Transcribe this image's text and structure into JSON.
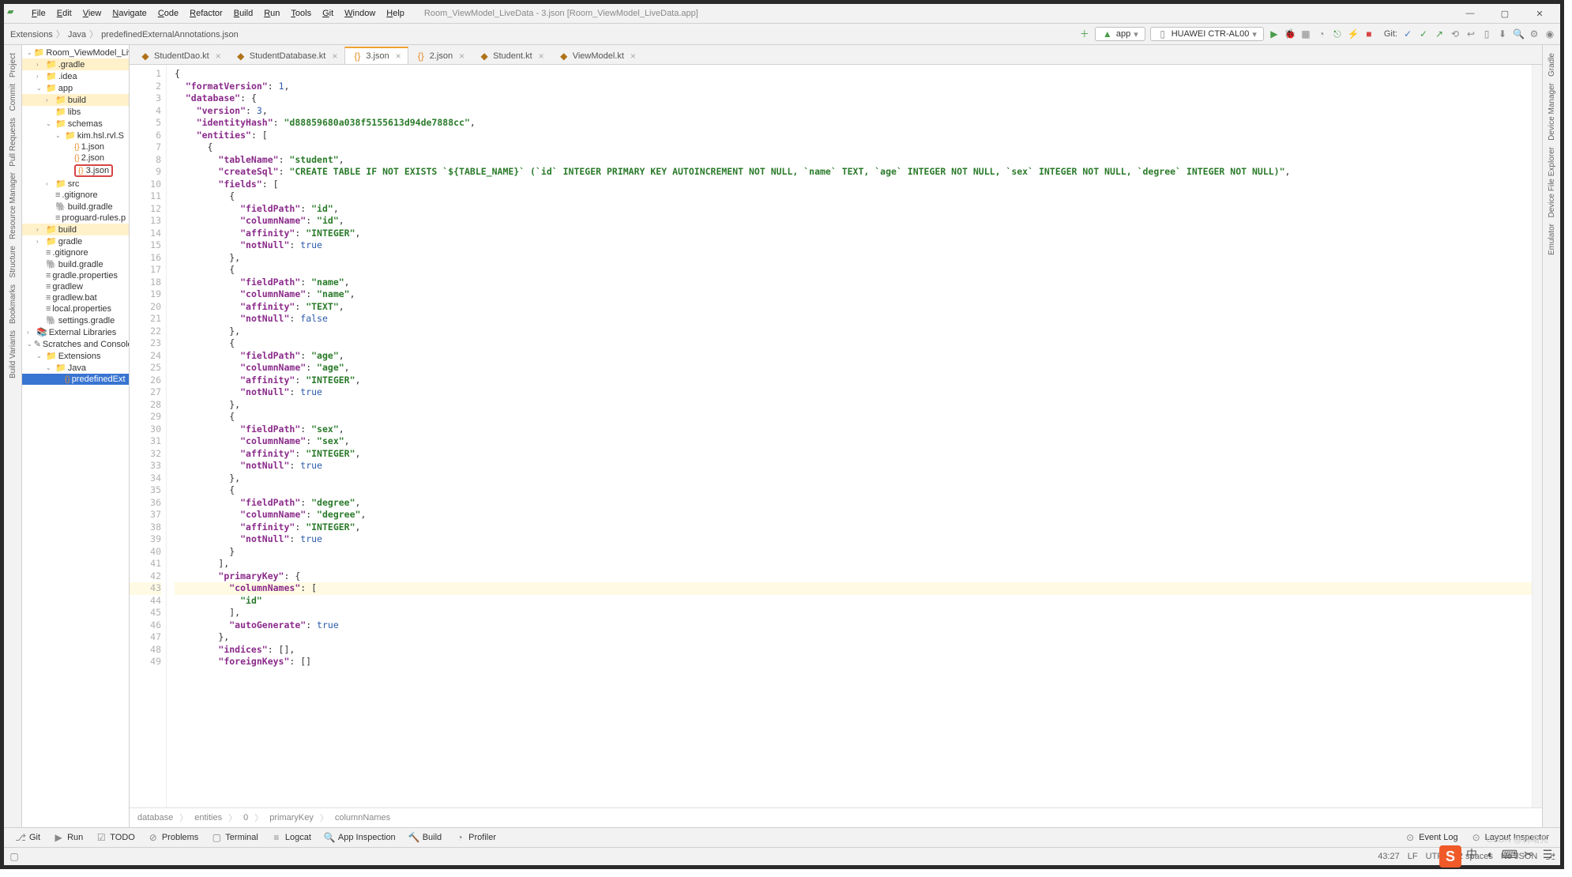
{
  "window_title": "Room_ViewModel_LiveData - 3.json [Room_ViewModel_LiveData.app]",
  "menu": [
    "File",
    "Edit",
    "View",
    "Navigate",
    "Code",
    "Refactor",
    "Build",
    "Run",
    "Tools",
    "Git",
    "Window",
    "Help"
  ],
  "breadcrumbs": [
    "Extensions",
    "Java",
    "predefinedExternalAnnotations.json"
  ],
  "run_config": "app",
  "device": "HUAWEI CTR-AL00",
  "git_label": "Git:",
  "editor_tabs": [
    {
      "label": "StudentDao.kt",
      "icon": "kotlin",
      "active": false
    },
    {
      "label": "StudentDatabase.kt",
      "icon": "kotlin",
      "active": false
    },
    {
      "label": "3.json",
      "icon": "json",
      "active": true
    },
    {
      "label": "2.json",
      "icon": "json",
      "active": false
    },
    {
      "label": "Student.kt",
      "icon": "kotlin",
      "active": false
    },
    {
      "label": "ViewModel.kt",
      "icon": "kotlin",
      "active": false
    }
  ],
  "left_tabs": [
    "Project",
    "Commit",
    "Pull Requests",
    "Resource Manager",
    "Structure",
    "Bookmarks",
    "Build Variants"
  ],
  "right_tabs": [
    "Gradle",
    "Device Manager",
    "Device File Explorer",
    "Emulator"
  ],
  "tree": [
    {
      "d": 0,
      "a": "v",
      "i": "proj",
      "t": "Room_ViewModel_LiveDa"
    },
    {
      "d": 1,
      "a": ">",
      "i": "fold-hi",
      "t": ".gradle",
      "hi": true
    },
    {
      "d": 1,
      "a": ">",
      "i": "fold",
      "t": ".idea"
    },
    {
      "d": 1,
      "a": "v",
      "i": "mod",
      "t": "app"
    },
    {
      "d": 2,
      "a": ">",
      "i": "fold-hi",
      "t": "build",
      "hi": true
    },
    {
      "d": 2,
      "a": "",
      "i": "fold",
      "t": "libs"
    },
    {
      "d": 2,
      "a": "v",
      "i": "fold",
      "t": "schemas"
    },
    {
      "d": 3,
      "a": "v",
      "i": "fold",
      "t": "kim.hsl.rvl.S"
    },
    {
      "d": 4,
      "a": "",
      "i": "json",
      "t": "1.json"
    },
    {
      "d": 4,
      "a": "",
      "i": "json",
      "t": "2.json"
    },
    {
      "d": 4,
      "a": "",
      "i": "json",
      "t": "3.json",
      "box": true
    },
    {
      "d": 2,
      "a": ">",
      "i": "fold",
      "t": "src"
    },
    {
      "d": 2,
      "a": "",
      "i": "file",
      "t": ".gitignore"
    },
    {
      "d": 2,
      "a": "",
      "i": "gradle",
      "t": "build.gradle"
    },
    {
      "d": 2,
      "a": "",
      "i": "file",
      "t": "proguard-rules.p"
    },
    {
      "d": 1,
      "a": ">",
      "i": "fold-hi",
      "t": "build",
      "hi": true
    },
    {
      "d": 1,
      "a": ">",
      "i": "fold",
      "t": "gradle"
    },
    {
      "d": 1,
      "a": "",
      "i": "file",
      "t": ".gitignore"
    },
    {
      "d": 1,
      "a": "",
      "i": "gradle",
      "t": "build.gradle"
    },
    {
      "d": 1,
      "a": "",
      "i": "file",
      "t": "gradle.properties"
    },
    {
      "d": 1,
      "a": "",
      "i": "file",
      "t": "gradlew"
    },
    {
      "d": 1,
      "a": "",
      "i": "file",
      "t": "gradlew.bat"
    },
    {
      "d": 1,
      "a": "",
      "i": "file",
      "t": "local.properties"
    },
    {
      "d": 1,
      "a": "",
      "i": "gradle",
      "t": "settings.gradle"
    },
    {
      "d": 0,
      "a": ">",
      "i": "lib",
      "t": "External Libraries"
    },
    {
      "d": 0,
      "a": "v",
      "i": "scratch",
      "t": "Scratches and Console"
    },
    {
      "d": 1,
      "a": "v",
      "i": "fold",
      "t": "Extensions"
    },
    {
      "d": 2,
      "a": "v",
      "i": "fold",
      "t": "Java"
    },
    {
      "d": 3,
      "a": "",
      "i": "json",
      "t": "predefinedExt",
      "sel": true
    }
  ],
  "code": [
    {
      "n": 1,
      "seg": [
        [
          "p",
          "{"
        ]
      ]
    },
    {
      "n": 2,
      "seg": [
        [
          "p",
          "  "
        ],
        [
          "k",
          "\"formatVersion\""
        ],
        [
          "p",
          ": "
        ],
        [
          "n",
          "1"
        ],
        [
          "p",
          ","
        ]
      ]
    },
    {
      "n": 3,
      "seg": [
        [
          "p",
          "  "
        ],
        [
          "k",
          "\"database\""
        ],
        [
          "p",
          ": {"
        ]
      ]
    },
    {
      "n": 4,
      "seg": [
        [
          "p",
          "    "
        ],
        [
          "k",
          "\"version\""
        ],
        [
          "p",
          ": "
        ],
        [
          "n",
          "3"
        ],
        [
          "p",
          ","
        ]
      ]
    },
    {
      "n": 5,
      "seg": [
        [
          "p",
          "    "
        ],
        [
          "k",
          "\"identityHash\""
        ],
        [
          "p",
          ": "
        ],
        [
          "s",
          "\"d88859680a038f5155613d94de7888cc\""
        ],
        [
          "p",
          ","
        ]
      ]
    },
    {
      "n": 6,
      "seg": [
        [
          "p",
          "    "
        ],
        [
          "k",
          "\"entities\""
        ],
        [
          "p",
          ": ["
        ]
      ]
    },
    {
      "n": 7,
      "seg": [
        [
          "p",
          "      {"
        ]
      ]
    },
    {
      "n": 8,
      "seg": [
        [
          "p",
          "        "
        ],
        [
          "k",
          "\"tableName\""
        ],
        [
          "p",
          ": "
        ],
        [
          "s",
          "\"student\""
        ],
        [
          "p",
          ","
        ]
      ]
    },
    {
      "n": 9,
      "seg": [
        [
          "p",
          "        "
        ],
        [
          "k",
          "\"createSql\""
        ],
        [
          "p",
          ": "
        ],
        [
          "s",
          "\"CREATE TABLE IF NOT EXISTS `${TABLE_NAME}` (`id` INTEGER PRIMARY KEY AUTOINCREMENT NOT NULL, `name` TEXT, `age` INTEGER NOT NULL, `sex` INTEGER NOT NULL, `degree` INTEGER NOT NULL)\""
        ],
        [
          "p",
          ","
        ]
      ]
    },
    {
      "n": 10,
      "seg": [
        [
          "p",
          "        "
        ],
        [
          "k",
          "\"fields\""
        ],
        [
          "p",
          ": ["
        ]
      ]
    },
    {
      "n": 11,
      "seg": [
        [
          "p",
          "          {"
        ]
      ]
    },
    {
      "n": 12,
      "seg": [
        [
          "p",
          "            "
        ],
        [
          "k",
          "\"fieldPath\""
        ],
        [
          "p",
          ": "
        ],
        [
          "s",
          "\"id\""
        ],
        [
          "p",
          ","
        ]
      ]
    },
    {
      "n": 13,
      "seg": [
        [
          "p",
          "            "
        ],
        [
          "k",
          "\"columnName\""
        ],
        [
          "p",
          ": "
        ],
        [
          "s",
          "\"id\""
        ],
        [
          "p",
          ","
        ]
      ]
    },
    {
      "n": 14,
      "seg": [
        [
          "p",
          "            "
        ],
        [
          "k",
          "\"affinity\""
        ],
        [
          "p",
          ": "
        ],
        [
          "s",
          "\"INTEGER\""
        ],
        [
          "p",
          ","
        ]
      ]
    },
    {
      "n": 15,
      "seg": [
        [
          "p",
          "            "
        ],
        [
          "k",
          "\"notNull\""
        ],
        [
          "p",
          ": "
        ],
        [
          "n",
          "true"
        ]
      ]
    },
    {
      "n": 16,
      "seg": [
        [
          "p",
          "          },"
        ]
      ]
    },
    {
      "n": 17,
      "seg": [
        [
          "p",
          "          {"
        ]
      ]
    },
    {
      "n": 18,
      "seg": [
        [
          "p",
          "            "
        ],
        [
          "k",
          "\"fieldPath\""
        ],
        [
          "p",
          ": "
        ],
        [
          "s",
          "\"name\""
        ],
        [
          "p",
          ","
        ]
      ]
    },
    {
      "n": 19,
      "seg": [
        [
          "p",
          "            "
        ],
        [
          "k",
          "\"columnName\""
        ],
        [
          "p",
          ": "
        ],
        [
          "s",
          "\"name\""
        ],
        [
          "p",
          ","
        ]
      ]
    },
    {
      "n": 20,
      "seg": [
        [
          "p",
          "            "
        ],
        [
          "k",
          "\"affinity\""
        ],
        [
          "p",
          ": "
        ],
        [
          "s",
          "\"TEXT\""
        ],
        [
          "p",
          ","
        ]
      ]
    },
    {
      "n": 21,
      "seg": [
        [
          "p",
          "            "
        ],
        [
          "k",
          "\"notNull\""
        ],
        [
          "p",
          ": "
        ],
        [
          "n",
          "false"
        ]
      ]
    },
    {
      "n": 22,
      "seg": [
        [
          "p",
          "          },"
        ]
      ]
    },
    {
      "n": 23,
      "seg": [
        [
          "p",
          "          {"
        ]
      ]
    },
    {
      "n": 24,
      "seg": [
        [
          "p",
          "            "
        ],
        [
          "k",
          "\"fieldPath\""
        ],
        [
          "p",
          ": "
        ],
        [
          "s",
          "\"age\""
        ],
        [
          "p",
          ","
        ]
      ]
    },
    {
      "n": 25,
      "seg": [
        [
          "p",
          "            "
        ],
        [
          "k",
          "\"columnName\""
        ],
        [
          "p",
          ": "
        ],
        [
          "s",
          "\"age\""
        ],
        [
          "p",
          ","
        ]
      ]
    },
    {
      "n": 26,
      "seg": [
        [
          "p",
          "            "
        ],
        [
          "k",
          "\"affinity\""
        ],
        [
          "p",
          ": "
        ],
        [
          "s",
          "\"INTEGER\""
        ],
        [
          "p",
          ","
        ]
      ]
    },
    {
      "n": 27,
      "seg": [
        [
          "p",
          "            "
        ],
        [
          "k",
          "\"notNull\""
        ],
        [
          "p",
          ": "
        ],
        [
          "n",
          "true"
        ]
      ]
    },
    {
      "n": 28,
      "seg": [
        [
          "p",
          "          },"
        ]
      ]
    },
    {
      "n": 29,
      "seg": [
        [
          "p",
          "          {"
        ]
      ]
    },
    {
      "n": 30,
      "seg": [
        [
          "p",
          "            "
        ],
        [
          "k",
          "\"fieldPath\""
        ],
        [
          "p",
          ": "
        ],
        [
          "s",
          "\"sex\""
        ],
        [
          "p",
          ","
        ]
      ]
    },
    {
      "n": 31,
      "seg": [
        [
          "p",
          "            "
        ],
        [
          "k",
          "\"columnName\""
        ],
        [
          "p",
          ": "
        ],
        [
          "s",
          "\"sex\""
        ],
        [
          "p",
          ","
        ]
      ]
    },
    {
      "n": 32,
      "seg": [
        [
          "p",
          "            "
        ],
        [
          "k",
          "\"affinity\""
        ],
        [
          "p",
          ": "
        ],
        [
          "s",
          "\"INTEGER\""
        ],
        [
          "p",
          ","
        ]
      ]
    },
    {
      "n": 33,
      "seg": [
        [
          "p",
          "            "
        ],
        [
          "k",
          "\"notNull\""
        ],
        [
          "p",
          ": "
        ],
        [
          "n",
          "true"
        ]
      ]
    },
    {
      "n": 34,
      "seg": [
        [
          "p",
          "          },"
        ]
      ]
    },
    {
      "n": 35,
      "seg": [
        [
          "p",
          "          {"
        ]
      ]
    },
    {
      "n": 36,
      "seg": [
        [
          "p",
          "            "
        ],
        [
          "k",
          "\"fieldPath\""
        ],
        [
          "p",
          ": "
        ],
        [
          "s",
          "\"degree\""
        ],
        [
          "p",
          ","
        ]
      ]
    },
    {
      "n": 37,
      "seg": [
        [
          "p",
          "            "
        ],
        [
          "k",
          "\"columnName\""
        ],
        [
          "p",
          ": "
        ],
        [
          "s",
          "\"degree\""
        ],
        [
          "p",
          ","
        ]
      ]
    },
    {
      "n": 38,
      "seg": [
        [
          "p",
          "            "
        ],
        [
          "k",
          "\"affinity\""
        ],
        [
          "p",
          ": "
        ],
        [
          "s",
          "\"INTEGER\""
        ],
        [
          "p",
          ","
        ]
      ]
    },
    {
      "n": 39,
      "seg": [
        [
          "p",
          "            "
        ],
        [
          "k",
          "\"notNull\""
        ],
        [
          "p",
          ": "
        ],
        [
          "n",
          "true"
        ]
      ]
    },
    {
      "n": 40,
      "seg": [
        [
          "p",
          "          }"
        ]
      ]
    },
    {
      "n": 41,
      "seg": [
        [
          "p",
          "        ],"
        ]
      ]
    },
    {
      "n": 42,
      "seg": [
        [
          "p",
          "        "
        ],
        [
          "k",
          "\"primaryKey\""
        ],
        [
          "p",
          ": {"
        ]
      ]
    },
    {
      "n": 43,
      "hl": true,
      "seg": [
        [
          "p",
          "          "
        ],
        [
          "k",
          "\"columnNames\""
        ],
        [
          "p",
          ": ["
        ]
      ]
    },
    {
      "n": 44,
      "seg": [
        [
          "p",
          "            "
        ],
        [
          "s",
          "\"id\""
        ]
      ]
    },
    {
      "n": 45,
      "seg": [
        [
          "p",
          "          ],"
        ]
      ]
    },
    {
      "n": 46,
      "seg": [
        [
          "p",
          "          "
        ],
        [
          "k",
          "\"autoGenerate\""
        ],
        [
          "p",
          ": "
        ],
        [
          "n",
          "true"
        ]
      ]
    },
    {
      "n": 47,
      "seg": [
        [
          "p",
          "        },"
        ]
      ]
    },
    {
      "n": 48,
      "seg": [
        [
          "p",
          "        "
        ],
        [
          "k",
          "\"indices\""
        ],
        [
          "p",
          ": [],"
        ]
      ]
    },
    {
      "n": 49,
      "seg": [
        [
          "p",
          "        "
        ],
        [
          "k",
          "\"foreignKeys\""
        ],
        [
          "p",
          ": []"
        ]
      ]
    }
  ],
  "code_crumb": [
    "database",
    "entities",
    "0",
    "primaryKey",
    "columnNames"
  ],
  "bottom_tabs": [
    "Git",
    "Run",
    "TODO",
    "Problems",
    "Terminal",
    "Logcat",
    "App Inspection",
    "Build",
    "Profiler"
  ],
  "bottom_right": [
    "Event Log",
    "Layout Inspector"
  ],
  "status": {
    "pos": "43:27",
    "enc": "LF",
    "charset": "UTF-8",
    "indent": "2 spaces",
    "schema": "No JSON"
  },
  "watermark": "CSDN @韩曙亮"
}
